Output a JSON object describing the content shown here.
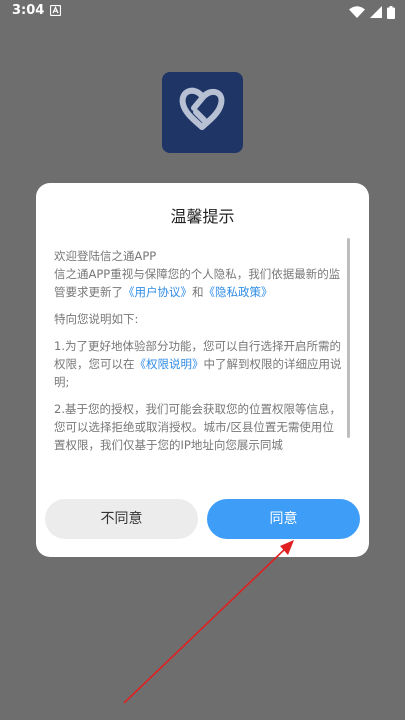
{
  "status_bar": {
    "time": "3:04",
    "icons": [
      "notification-icon",
      "wifi-icon",
      "signal-icon",
      "battery-icon"
    ],
    "color": "#ffffff"
  },
  "app": {
    "logo_icon": "heart-link-logo",
    "logo_bg": "#1e3566"
  },
  "dialog": {
    "title": "温馨提示",
    "intro_line1": "欢迎登陆信之通APP",
    "intro_line2_text": "信之通APP重视与保障您的个人隐私，我们依据最新的监管要求更新了",
    "link_user_agreement": "《用户协议》",
    "and_text": "和",
    "link_privacy_policy": "《隐私政策》",
    "special_note": "特向您说明如下:",
    "item1_before": "1.为了更好地体验部分功能，您可以自行选择开启所需的权限，您可以在",
    "link_permission_note": "《权限说明》",
    "item1_after": "中了解到权限的详细应用说明;",
    "item2_text": "2.基于您的授权，我们可能会获取您的位置权限等信息，您可以选择拒绝或取消授权。城市/区县位置无需使用位置权限，我们仅基于您的IP地址向您展示同城",
    "disagree_button": "不同意",
    "agree_button": "同意",
    "link_color": "#2f8ce6",
    "agree_color": "#3e9df7"
  },
  "annotation": {
    "arrow_color": "#e02020"
  }
}
